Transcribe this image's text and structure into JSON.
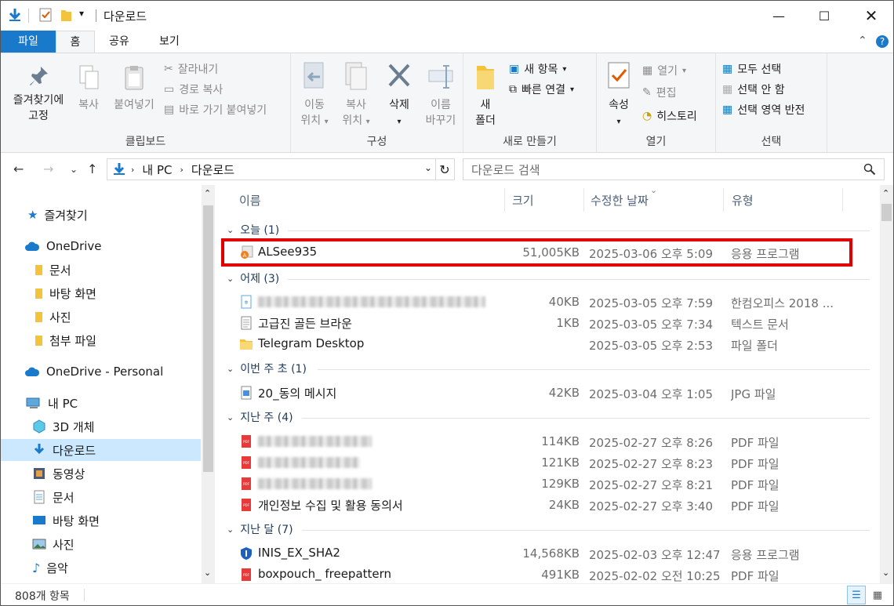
{
  "window": {
    "title": "다운로드"
  },
  "ribbon_tabs": {
    "file": "파일",
    "home": "홈",
    "share": "공유",
    "view": "보기"
  },
  "clipboard": {
    "pin_line1": "즐겨찾기에",
    "pin_line2": "고정",
    "copy": "복사",
    "paste": "붙여넣기",
    "cut": "잘라내기",
    "copy_path": "경로 복사",
    "paste_shortcut": "바로 가기 붙여넣기",
    "label": "클립보드"
  },
  "organize": {
    "move_line1": "이동",
    "move_line2": "위치",
    "copyto_line1": "복사",
    "copyto_line2": "위치",
    "delete": "삭제",
    "rename_line1": "이름",
    "rename_line2": "바꾸기",
    "label": "구성"
  },
  "new": {
    "folder_line1": "새",
    "folder_line2": "폴더",
    "new_item": "새 항목",
    "easy_access": "빠른 연결",
    "label": "새로 만들기"
  },
  "open": {
    "properties": "속성",
    "open": "열기",
    "edit": "편집",
    "history": "히스토리",
    "label": "열기"
  },
  "select": {
    "all": "모두 선택",
    "none": "선택 안 함",
    "invert": "선택 영역 반전",
    "label": "선택"
  },
  "address": {
    "pc": "내 PC",
    "folder": "다운로드"
  },
  "search": {
    "placeholder": "다운로드 검색"
  },
  "nav": {
    "quick_access": "즐겨찾기",
    "onedrive": "OneDrive",
    "onedrive_items": [
      "문서",
      "바탕 화면",
      "사진",
      "첨부 파일"
    ],
    "onedrive_personal": "OneDrive - Personal",
    "this_pc": "내 PC",
    "pc_items": [
      "3D 개체",
      "다운로드",
      "동영상",
      "문서",
      "바탕 화면",
      "사진",
      "음악"
    ]
  },
  "columns": {
    "name": "이름",
    "size": "크기",
    "date": "수정한 날짜",
    "type": "유형"
  },
  "groups": [
    {
      "label": "오늘 (1)"
    },
    {
      "label": "어제 (3)"
    },
    {
      "label": "이번 주 초 (1)"
    },
    {
      "label": "지난 주 (4)"
    },
    {
      "label": "지난 달 (7)"
    }
  ],
  "files": [
    {
      "name": "ALSee935",
      "size": "51,005KB",
      "date": "2025-03-06 오후 5:09",
      "type": "응용 프로그램",
      "icon": "alsee-icon"
    },
    {
      "name": "",
      "size": "40KB",
      "date": "2025-03-05 오후 7:59",
      "type": "한컴오피스 2018 ...",
      "icon": "hwp-icon"
    },
    {
      "name": "고급진 골든 브라운",
      "size": "1KB",
      "date": "2025-03-05 오후 7:34",
      "type": "텍스트 문서",
      "icon": "text-file-icon"
    },
    {
      "name": "Telegram Desktop",
      "size": "",
      "date": "2025-03-05 오후 2:53",
      "type": "파일 폴더",
      "icon": "folder-icon"
    },
    {
      "name": "20_동의 메시지",
      "size": "42KB",
      "date": "2025-03-04 오후 1:05",
      "type": "JPG 파일",
      "icon": "image-file-icon"
    },
    {
      "name": "",
      "size": "114KB",
      "date": "2025-02-27 오후 8:26",
      "type": "PDF 파일",
      "icon": "pdf-icon"
    },
    {
      "name": "",
      "size": "121KB",
      "date": "2025-02-27 오후 8:23",
      "type": "PDF 파일",
      "icon": "pdf-icon"
    },
    {
      "name": "",
      "size": "129KB",
      "date": "2025-02-27 오후 8:21",
      "type": "PDF 파일",
      "icon": "pdf-icon"
    },
    {
      "name": "개인정보 수집 및 활용 동의서",
      "size": "24KB",
      "date": "2025-02-27 오후 3:40",
      "type": "PDF 파일",
      "icon": "pdf-icon"
    },
    {
      "name": "INIS_EX_SHA2",
      "size": "14,568KB",
      "date": "2025-02-03 오후 12:47",
      "type": "응용 프로그램",
      "icon": "shield-icon"
    },
    {
      "name": "boxpouch_ freepattern",
      "size": "491KB",
      "date": "2025-02-02 오전 10:25",
      "type": "PDF 파일",
      "icon": "pdf-icon"
    }
  ],
  "status": {
    "count": "808개 항목"
  },
  "colors": {
    "accent": "#1979ca",
    "selected": "#cce8ff",
    "highlight_border": "#e00000"
  }
}
